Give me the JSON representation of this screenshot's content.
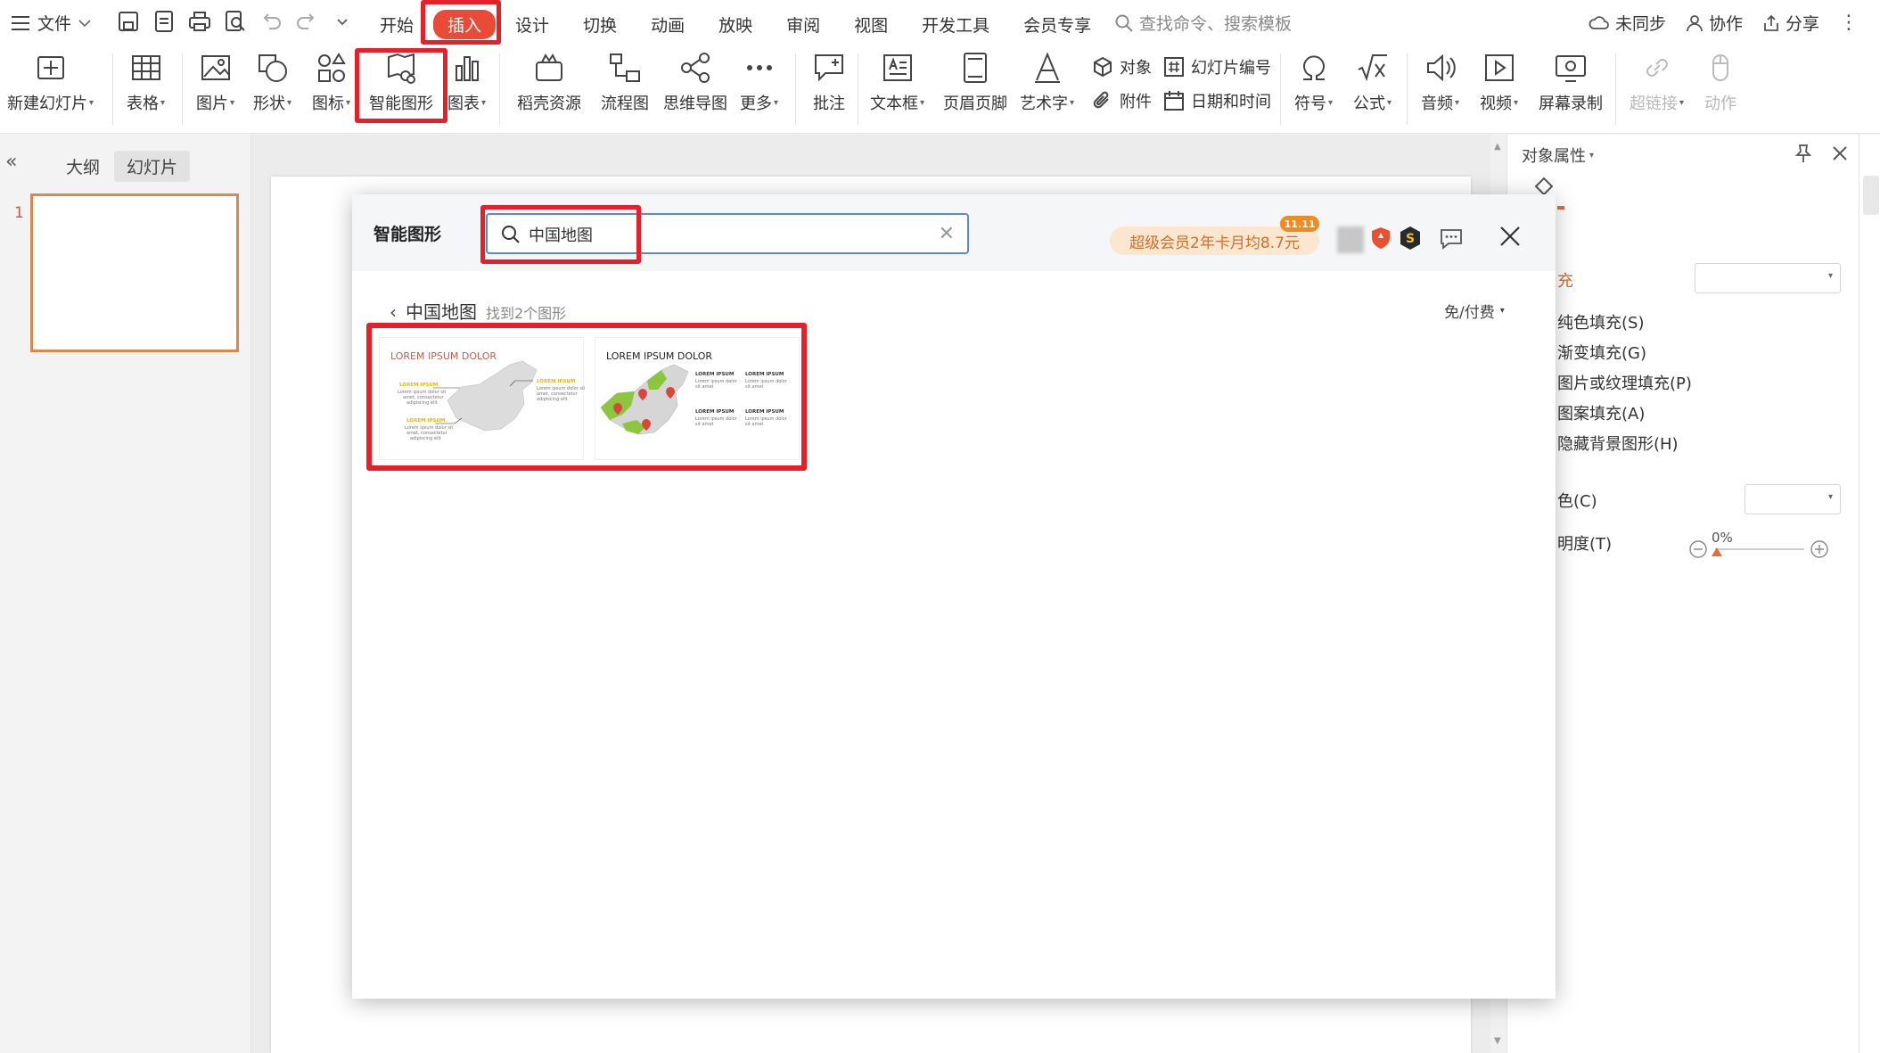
{
  "menubar": {
    "file_label": "文件",
    "tabs": [
      {
        "label": "开始"
      },
      {
        "label": "插入",
        "active": true
      },
      {
        "label": "设计"
      },
      {
        "label": "切换"
      },
      {
        "label": "动画"
      },
      {
        "label": "放映"
      },
      {
        "label": "审阅"
      },
      {
        "label": "视图"
      },
      {
        "label": "开发工具"
      },
      {
        "label": "会员专享"
      }
    ],
    "search_placeholder": "查找命令、搜索模板",
    "right": {
      "sync": "未同步",
      "collab": "协作",
      "share": "分享"
    }
  },
  "ribbon": {
    "new_slide": "新建幻灯片",
    "table": "表格",
    "picture": "图片",
    "shape": "形状",
    "icon": "图标",
    "smart_graphic": "智能图形",
    "chart": "图表",
    "docer_resources": "稻壳资源",
    "flowchart": "流程图",
    "mindmap": "思维导图",
    "more": "更多",
    "comment": "批注",
    "textbox": "文本框",
    "header_footer": "页眉页脚",
    "wordart": "艺术字",
    "object": "对象",
    "slide_number": "幻灯片编号",
    "attachment": "附件",
    "date_time": "日期和时间",
    "symbol": "符号",
    "formula": "公式",
    "audio": "音频",
    "video": "视频",
    "screen_record": "屏幕录制",
    "hyperlink": "超链接",
    "action": "动作"
  },
  "left_panel": {
    "tabs": [
      {
        "label": "大纲"
      },
      {
        "label": "幻灯片",
        "active": true
      }
    ],
    "slides": [
      {
        "number": "1"
      }
    ]
  },
  "right_panel": {
    "title": "对象属性",
    "section_label": "充",
    "options": [
      "纯色填充(S)",
      "渐变填充(G)",
      "图片或纹理填充(P)",
      "图案填充(A)",
      "隐藏背景图形(H)"
    ],
    "color_label": "色(C)",
    "transparency_label": "明度(T)",
    "transparency_value": "0%"
  },
  "dialog": {
    "title": "智能图形",
    "search_value": "中国地图",
    "promo": "超级会员2年卡月均8.7元",
    "promo_tag": "11.11",
    "breadcrumb": "中国地图",
    "result_count": "找到2个图形",
    "price_filter": "免/付费",
    "results": [
      {
        "title": "LOREM IPSUM DOLOR",
        "callouts": [
          "LOREM IPSUM",
          "LOREM IPSUM",
          "LOREM IPSUM"
        ],
        "body": [
          "Lorem ipsum dolor sit",
          "amet, consectetur",
          "adipiscing elit"
        ]
      },
      {
        "title": "LOREM IPSUM DOLOR",
        "items": [
          {
            "heading": "LOREM IPSUM",
            "text": [
              "Lorem ipsum dolor",
              "sit amet"
            ]
          },
          {
            "heading": "LOREM IPSUM",
            "text": [
              "Lorem ipsum dolor",
              "sit amet"
            ]
          },
          {
            "heading": "LOREM IPSUM",
            "text": [
              "Lorem ipsum dolor",
              "sit amet"
            ]
          },
          {
            "heading": "LOREM IPSUM",
            "text": [
              "Lorem ipsum dolor",
              "sit amet"
            ]
          }
        ]
      }
    ]
  },
  "colors": {
    "accent_red": "#e5202a",
    "active_tab": "#ea4b39",
    "map_green": "#8cc63f",
    "pin_red": "#d9463b",
    "promo_text": "#d0702a"
  }
}
